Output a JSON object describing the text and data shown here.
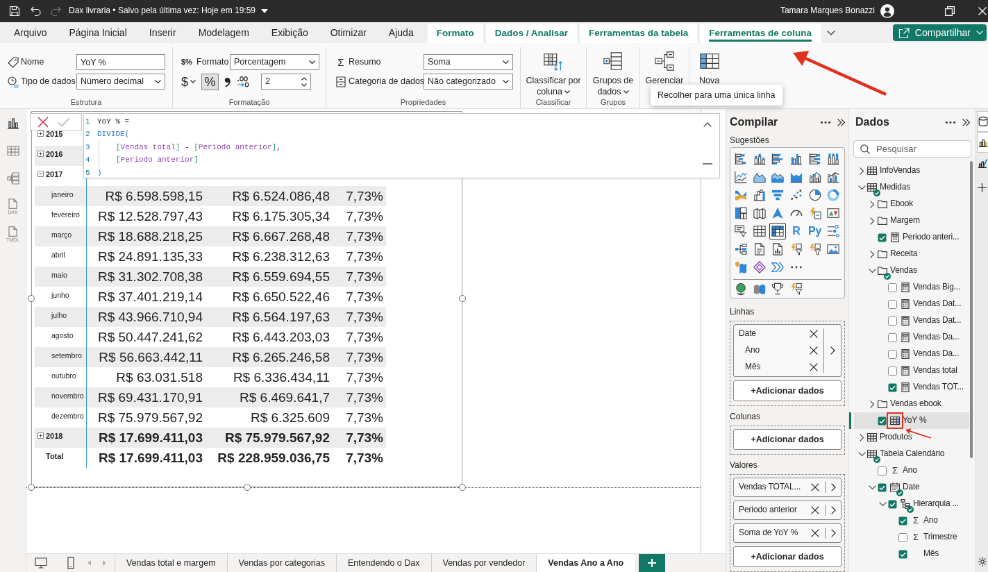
{
  "title_bar": {
    "quick_actions": [
      {
        "kind": "save",
        "disabled": false
      },
      {
        "kind": "undo",
        "disabled": false
      },
      {
        "kind": "redo",
        "disabled": true
      }
    ],
    "document_title": "Dax livraria • Salvo pela última vez: Hoje em 19:59",
    "user_name": "Tamara Marques Bonazzi"
  },
  "ribbon_tabs": [
    {
      "label": "Arquivo",
      "kind": "main",
      "selected": false
    },
    {
      "label": "Página Inicial",
      "kind": "main",
      "selected": false
    },
    {
      "label": "Inserir",
      "kind": "main",
      "selected": false
    },
    {
      "label": "Modelagem",
      "kind": "main",
      "selected": false
    },
    {
      "label": "Exibição",
      "kind": "main",
      "selected": false
    },
    {
      "label": "Otimizar",
      "kind": "main",
      "selected": false
    },
    {
      "label": "Ajuda",
      "kind": "main",
      "selected": false
    },
    {
      "label": "Formato",
      "kind": "contextual",
      "selected": false
    },
    {
      "label": "Dados / Analisar",
      "kind": "contextual",
      "selected": false
    },
    {
      "label": "Ferramentas da tabela",
      "kind": "contextual",
      "selected": false
    },
    {
      "label": "Ferramentas de coluna",
      "kind": "contextual",
      "selected": true
    }
  ],
  "share_button": {
    "label": "Compartilhar"
  },
  "ribbon_groups": [
    {
      "kind": "fields",
      "label": "Estrutura",
      "rows": [
        {
          "kind": "name",
          "label": "Nome",
          "field": {
            "kind": "text",
            "value": "YoY %"
          }
        },
        {
          "kind": "data-type",
          "label": "Tipo de dados",
          "field": {
            "kind": "select",
            "value": "Número decimal"
          }
        }
      ]
    },
    {
      "kind": "format",
      "label": "Formatação",
      "format": {
        "symbol": "$%",
        "label": "Formato",
        "value": "Porcentagem"
      },
      "currency": {
        "symbol": "$"
      },
      "percent": {
        "symbol": "%",
        "on": true
      },
      "decimals": {
        "value": "2"
      }
    },
    {
      "kind": "fields",
      "label": "Propriedades",
      "rows": [
        {
          "kind": "summary",
          "symbol": "Σ",
          "label": "Resumo",
          "field": {
            "kind": "select",
            "value": "Soma"
          }
        },
        {
          "kind": "category",
          "label": "Categoria de dados",
          "field": {
            "kind": "select",
            "value": "Não categorizado"
          }
        }
      ]
    },
    {
      "kind": "large",
      "label": "Classificar",
      "button": {
        "kind": "sort",
        "label": "Classificar por coluna",
        "menu": true
      }
    },
    {
      "kind": "large",
      "label": "Grupos",
      "button": {
        "kind": "groups",
        "label": "Grupos de dados",
        "menu": true
      }
    },
    {
      "kind": "large",
      "button": {
        "kind": "relations",
        "label": "Gerenciar",
        "menu": false
      }
    },
    {
      "kind": "large",
      "button": {
        "kind": "new-column",
        "label": "Nova",
        "menu": false
      }
    }
  ],
  "tooltip": {
    "text": "Recolher para uma única linha"
  },
  "view_rail": [
    {
      "kind": "report",
      "selected": true
    },
    {
      "kind": "table",
      "selected": false
    },
    {
      "kind": "model",
      "selected": false
    },
    {
      "kind": "dax",
      "label": "DAX",
      "selected": false
    },
    {
      "kind": "tmdl",
      "label": "TMDL",
      "selected": false
    }
  ],
  "formula_bar": {
    "actions": [
      {
        "kind": "cancel",
        "disabled": false
      },
      {
        "kind": "commit",
        "disabled": true
      }
    ],
    "lines": [
      {
        "number": "1",
        "indented": false,
        "tokens": [
          {
            "kind": "plain",
            "text": "YoY % ="
          }
        ]
      },
      {
        "number": "2",
        "indented": false,
        "tokens": [
          {
            "kind": "function",
            "text": "DIVIDE("
          }
        ]
      },
      {
        "number": "3",
        "indented": true,
        "tokens": [
          {
            "kind": "bracket",
            "text": "["
          },
          {
            "kind": "measure",
            "text": "Vendas total"
          },
          {
            "kind": "bracket",
            "text": "]"
          },
          {
            "kind": "plain",
            "text": " - "
          },
          {
            "kind": "bracket",
            "text": "["
          },
          {
            "kind": "measure",
            "text": "Periodo anterior"
          },
          {
            "kind": "bracket",
            "text": "]"
          },
          {
            "kind": "plain",
            "text": ","
          }
        ]
      },
      {
        "number": "4",
        "indented": true,
        "tokens": [
          {
            "kind": "bracket",
            "text": "["
          },
          {
            "kind": "measure",
            "text": "Periodo anterior"
          },
          {
            "kind": "bracket",
            "text": "]"
          }
        ]
      },
      {
        "number": "5",
        "indented": false,
        "tokens": [
          {
            "kind": "function",
            "text": ")"
          }
        ]
      }
    ]
  },
  "matrix": {
    "rows": [
      {
        "label": "2015",
        "expanded": false
      },
      {
        "label": "2016",
        "expanded": false
      },
      {
        "label": "2017",
        "expanded": true,
        "children": [
          {
            "label": "janeiro",
            "values": [
              "R$ 6.598.598,15",
              "R$ 6.524.086,48",
              "7,73%"
            ]
          },
          {
            "label": "fevereiro",
            "values": [
              "R$ 12.528.797,43",
              "R$ 6.175.305,34",
              "7,73%"
            ]
          },
          {
            "label": "março",
            "values": [
              "R$ 18.688.218,25",
              "R$ 6.667.268,48",
              "7,73%"
            ]
          },
          {
            "label": "abril",
            "values": [
              "R$ 24.891.135,33",
              "R$ 6.238.312,63",
              "7,73%"
            ]
          },
          {
            "label": "maio",
            "values": [
              "R$ 31.302.708,38",
              "R$ 6.559.694,55",
              "7,73%"
            ]
          },
          {
            "label": "junho",
            "values": [
              "R$ 37.401.219,14",
              "R$ 6.650.522,46",
              "7,73%"
            ]
          },
          {
            "label": "julho",
            "values": [
              "R$ 43.966.710,94",
              "R$ 6.564.197,63",
              "7,73%"
            ]
          },
          {
            "label": "agosto",
            "values": [
              "R$ 50.447.241,62",
              "R$ 6.443.203,03",
              "7,73%"
            ]
          },
          {
            "label": "setembro",
            "values": [
              "R$ 56.663.442,11",
              "R$ 6.265.246,58",
              "7,73%"
            ]
          },
          {
            "label": "outubro",
            "values": [
              "R$ 63.031.518",
              "R$ 6.336.434,11",
              "7,73%"
            ]
          },
          {
            "label": "novembro",
            "values": [
              "R$ 69.431.170,91",
              "R$ 6.469.641,7",
              "7,73%"
            ]
          },
          {
            "label": "dezembro",
            "values": [
              "R$ 75.979.567,92",
              "R$ 6.325.609",
              "7,73%"
            ]
          }
        ]
      },
      {
        "label": "2018",
        "expanded": false,
        "values": [
          "R$ 17.699.411,03",
          "R$ 75.979.567,92",
          "7,73%"
        ]
      },
      {
        "label": "Total",
        "values": [
          "R$ 17.699.411,03",
          "R$ 228.959.036,75",
          "7,73%"
        ]
      }
    ]
  },
  "page_tabs": [
    {
      "label": "Vendas total e margem",
      "selected": false
    },
    {
      "label": "Vendas por categorias",
      "selected": false
    },
    {
      "label": "Entendendo o Dax",
      "selected": false
    },
    {
      "label": "Vendas por vendedor",
      "selected": false
    },
    {
      "label": "Vendas Ano a Ano",
      "selected": true
    }
  ],
  "build_pane": {
    "title": "Compilar",
    "suggestions_label": "Sugestões",
    "visuals": [
      {
        "kind": "bar-stacked",
        "selected": false
      },
      {
        "kind": "column-stacked",
        "selected": false
      },
      {
        "kind": "bar-clustered",
        "selected": false
      },
      {
        "kind": "column-clustered",
        "selected": false
      },
      {
        "kind": "bar-100",
        "selected": false
      },
      {
        "kind": "column-100",
        "selected": false
      },
      {
        "kind": "line",
        "selected": false
      },
      {
        "kind": "area",
        "selected": false
      },
      {
        "kind": "area-stacked",
        "selected": false
      },
      {
        "kind": "area-filled",
        "selected": false
      },
      {
        "kind": "line-column",
        "selected": false
      },
      {
        "kind": "line-column-clustered",
        "selected": false
      },
      {
        "kind": "ribbon",
        "selected": false
      },
      {
        "kind": "waterfall",
        "selected": false
      },
      {
        "kind": "funnel",
        "selected": false
      },
      {
        "kind": "scatter",
        "selected": false
      },
      {
        "kind": "pie",
        "selected": false
      },
      {
        "kind": "donut",
        "selected": false
      },
      {
        "kind": "treemap",
        "selected": false
      },
      {
        "kind": "map",
        "selected": false
      },
      {
        "kind": "arrow",
        "selected": false
      },
      {
        "kind": "gauge",
        "selected": false
      },
      {
        "kind": "card",
        "selected": false
      },
      {
        "kind": "kpi",
        "selected": false
      },
      {
        "kind": "slicer",
        "selected": false
      },
      {
        "kind": "table",
        "selected": false
      },
      {
        "kind": "matrix",
        "selected": true
      },
      {
        "kind": "letters",
        "label": "R",
        "selected": false
      },
      {
        "kind": "letters",
        "label": "Py",
        "selected": false
      },
      {
        "kind": "key-influencers",
        "selected": false
      },
      {
        "kind": "decomposition",
        "selected": false
      },
      {
        "kind": "paginated",
        "selected": false
      },
      {
        "kind": "report-doc",
        "selected": false
      },
      {
        "kind": "lightning-filter",
        "selected": false
      },
      {
        "kind": "lightning-filter",
        "selected": false
      },
      {
        "kind": "image",
        "selected": false
      },
      {
        "kind": "shape-map",
        "selected": false
      },
      {
        "kind": "diamond",
        "selected": false
      },
      {
        "kind": "chevrons",
        "selected": false
      },
      {
        "kind": "more",
        "selected": false
      }
    ],
    "custom_visuals": [
      {
        "kind": "globe",
        "selected": false
      },
      {
        "kind": "filled-map",
        "selected": false
      },
      {
        "kind": "trophy",
        "selected": false
      },
      {
        "kind": "lightning-filter",
        "selected": false
      }
    ],
    "wells": [
      {
        "label": "Linhas",
        "fields": [
          {
            "kind": "hierarchy",
            "name": "Date",
            "levels": [
              "Ano",
              "Mês"
            ]
          }
        ],
        "add_label": "+Adicionar dados"
      },
      {
        "label": "Colunas",
        "add_label": "+Adicionar dados"
      },
      {
        "label": "Valores",
        "fields": [
          {
            "kind": "field",
            "name": "Vendas TOTAL..."
          },
          {
            "kind": "field",
            "name": "Periodo anterior"
          },
          {
            "kind": "field",
            "name": "Soma de YoY %"
          }
        ],
        "add_label": "+Adicionar dados"
      }
    ]
  },
  "data_pane": {
    "title": "Dados",
    "search_placeholder": "Pesquisar",
    "tree": [
      {
        "kind": "table",
        "label": "InfoVendas",
        "expanded": false,
        "in_use": false,
        "selected": false
      },
      {
        "kind": "table",
        "label": "Medidas",
        "expanded": true,
        "in_use": true,
        "selected": false,
        "children": [
          {
            "kind": "folder",
            "label": "Ebook",
            "expanded": false,
            "in_use": false,
            "selected": false
          },
          {
            "kind": "folder",
            "label": "Margem",
            "expanded": false,
            "in_use": false,
            "selected": false
          },
          {
            "kind": "measure",
            "label": "Periodo anteri...",
            "checked": true,
            "selected": false
          },
          {
            "kind": "folder",
            "label": "Receita",
            "expanded": false,
            "in_use": false,
            "selected": false
          },
          {
            "kind": "folder",
            "label": "Vendas",
            "expanded": true,
            "in_use": true,
            "selected": false,
            "children": [
              {
                "kind": "measure",
                "label": "Vendas Big...",
                "checked": false,
                "selected": false
              },
              {
                "kind": "measure",
                "label": "Vendas Dat...",
                "checked": false,
                "selected": false
              },
              {
                "kind": "measure",
                "label": "Vendas Dat...",
                "checked": false,
                "selected": false
              },
              {
                "kind": "measure",
                "label": "Vendas Da...",
                "checked": false,
                "selected": false
              },
              {
                "kind": "measure",
                "label": "Vendas Da...",
                "checked": false,
                "selected": false
              },
              {
                "kind": "measure",
                "label": "Vendas total",
                "checked": false,
                "selected": false
              },
              {
                "kind": "measure",
                "label": "Vendas TOT...",
                "checked": true,
                "selected": false
              }
            ]
          },
          {
            "kind": "folder",
            "label": "Vendas ebook",
            "expanded": false,
            "in_use": false,
            "selected": false
          },
          {
            "kind": "calc-column",
            "label": "YoY %",
            "checked": true,
            "selected": true
          }
        ]
      },
      {
        "kind": "table",
        "label": "Produtos",
        "expanded": false,
        "in_use": false,
        "selected": false
      },
      {
        "kind": "table",
        "label": "Tabela Calendário",
        "expanded": true,
        "in_use": true,
        "selected": false,
        "children": [
          {
            "kind": "sum-column",
            "symbol": "Σ",
            "label": "Ano",
            "checked": false,
            "selected": false
          },
          {
            "kind": "date",
            "label": "Date",
            "expanded": true,
            "checked": true,
            "in_use": true,
            "selected": false,
            "children": [
              {
                "kind": "hierarchy",
                "label": "Hierarquia ...",
                "expanded": true,
                "checked": true,
                "in_use": true,
                "selected": false,
                "children": [
                  {
                    "kind": "sum-column",
                    "symbol": "Σ",
                    "label": "Ano",
                    "checked": true,
                    "selected": false
                  },
                  {
                    "kind": "sum-column",
                    "symbol": "Σ",
                    "label": "Trimestre",
                    "checked": false,
                    "selected": false
                  },
                  {
                    "kind": "column",
                    "label": "Mês",
                    "checked": true,
                    "selected": false
                  }
                ]
              }
            ]
          }
        ]
      }
    ]
  },
  "pane_switcher": [
    {
      "kind": "data",
      "open": true
    },
    {
      "kind": "build",
      "open": true
    },
    {
      "kind": "format",
      "open": false
    }
  ]
}
